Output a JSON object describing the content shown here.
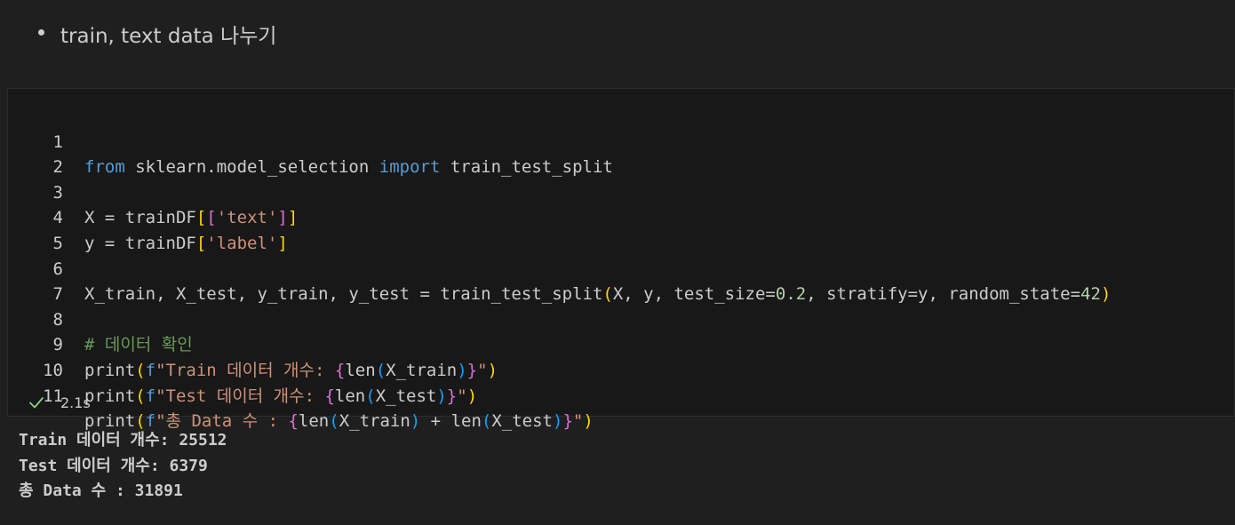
{
  "markdown": {
    "bullet_text": "train, text data 나누기"
  },
  "code": {
    "line_numbers": [
      "1",
      "2",
      "3",
      "4",
      "5",
      "6",
      "7",
      "8",
      "9",
      "10",
      "11"
    ],
    "l1": {
      "kw1": "from",
      "mod": " sklearn.model_selection ",
      "kw2": "import",
      "name": " train_test_split"
    },
    "l3": {
      "a": "X = trainDF",
      "ob": "[",
      "ib": "[",
      "s": "'text'",
      "cb1": "]",
      "cb2": "]"
    },
    "l4": {
      "a": "y = trainDF",
      "ob": "[",
      "s": "'label'",
      "cb": "]"
    },
    "l6": {
      "a": "X_train, X_test, y_train, y_test = train_test_split",
      "op": "(",
      "b": "X, y, test_size=",
      "n1": "0.2",
      "c": ", stratify=y, random_state=",
      "n2": "42",
      "cp": ")"
    },
    "l8": {
      "comment": "# 데이터 확인"
    },
    "l9": {
      "fn": "print",
      "op": "(",
      "f": "f",
      "s1": "\"Train 데이터 개수: ",
      "ob": "{",
      "len": "len",
      "ip": "(",
      "arg": "X_train",
      "cp2": ")",
      "cb": "}",
      "s2": "\"",
      "cp": ")"
    },
    "l10": {
      "fn": "print",
      "op": "(",
      "f": "f",
      "s1": "\"Test 데이터 개수: ",
      "ob": "{",
      "len": "len",
      "ip": "(",
      "arg": "X_test",
      "cp2": ")",
      "cb": "}",
      "s2": "\"",
      "cp": ")"
    },
    "l11": {
      "fn": "print",
      "op": "(",
      "f": "f",
      "s1": "\"총 Data 수 : ",
      "ob": "{",
      "len1": "len",
      "ip1": "(",
      "arg1": "X_train",
      "cp1": ")",
      "plus": " + ",
      "len2": "len",
      "ip2": "(",
      "arg2": "X_test",
      "cp2": ")",
      "cb": "}",
      "s2": "\"",
      "cp": ")"
    }
  },
  "execution": {
    "duration": "2.1s",
    "status_icon": "check-icon",
    "status_color": "#89d185"
  },
  "output": {
    "lines": [
      "Train 데이터 개수: 25512",
      "Test 데이터 개수: 6379",
      "총 Data 수 : 31891"
    ]
  }
}
